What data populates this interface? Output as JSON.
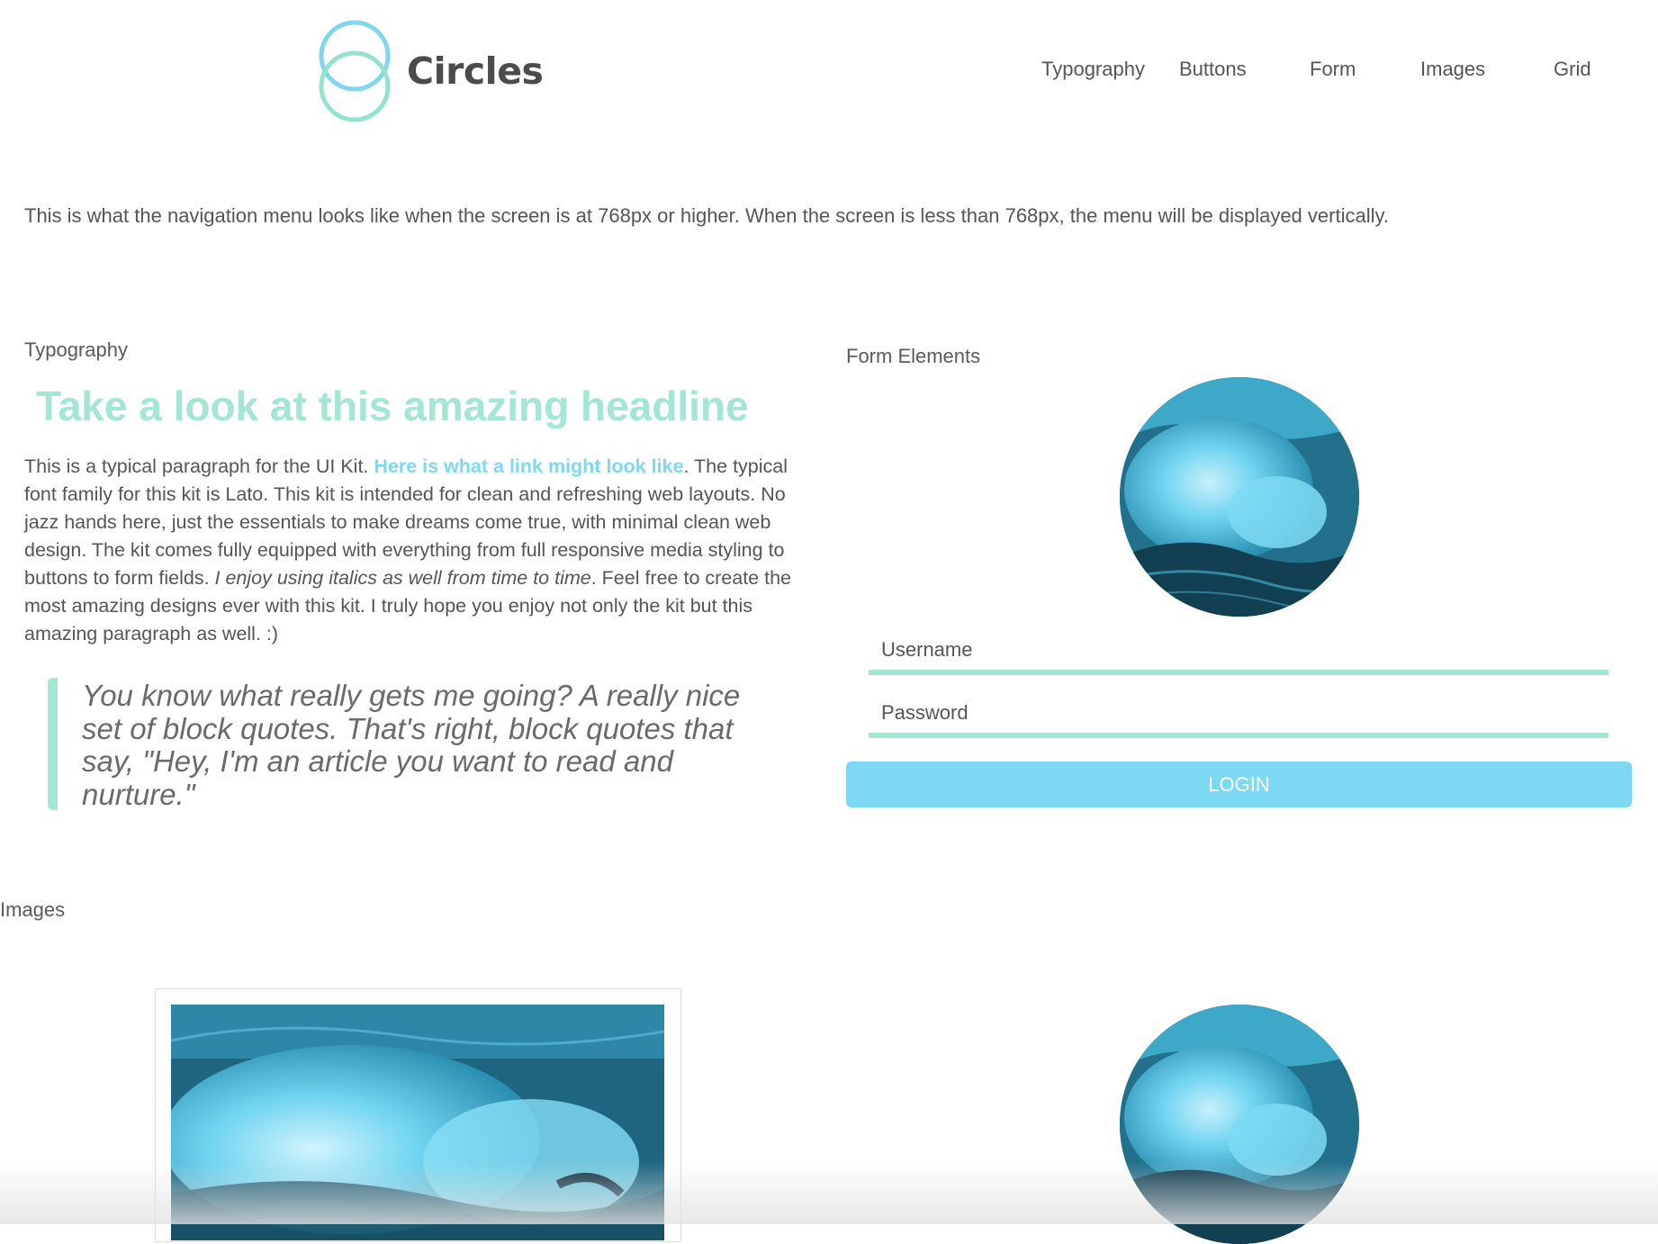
{
  "header": {
    "logo_text": "Circles",
    "nav": [
      "Typography",
      "Buttons",
      "Form",
      "Images",
      "Grid"
    ]
  },
  "nav_note": "This is what the navigation menu looks like when the screen is at 768px or higher. When the screen is less than 768px, the menu will be displayed vertically.",
  "typography": {
    "label": "Typography",
    "headline": "Take a look at this amazing headline",
    "paragraph": {
      "intro": "This is a typical paragraph for the UI Kit. ",
      "link": "Here is what a link might look like",
      "middle": ". The typical font family for this kit is Lato. This kit is intended for clean and refreshing web layouts. No jazz hands here, just the essentials to make dreams come true, with minimal clean web design. The kit comes fully equipped with everything from full responsive media styling to buttons to form fields. ",
      "italic": "I enjoy using italics as well from time to time",
      "outro": ". Feel free to create the most amazing designs ever with this kit. I truly hope you enjoy not only the kit but this amazing paragraph as well. :)"
    },
    "quote": "You know what really gets me going? A really nice set of block quotes. That's right, block quotes that say, \"Hey, I'm an article you want to read and nurture.\""
  },
  "form": {
    "label": "Form Elements",
    "username_placeholder": "Username",
    "password_placeholder": "Password",
    "login_label": "LOGIN"
  },
  "images": {
    "label": "Images"
  },
  "colors": {
    "mint": "#a3e6d4",
    "sky": "#7dd8f4",
    "text": "#555555"
  }
}
